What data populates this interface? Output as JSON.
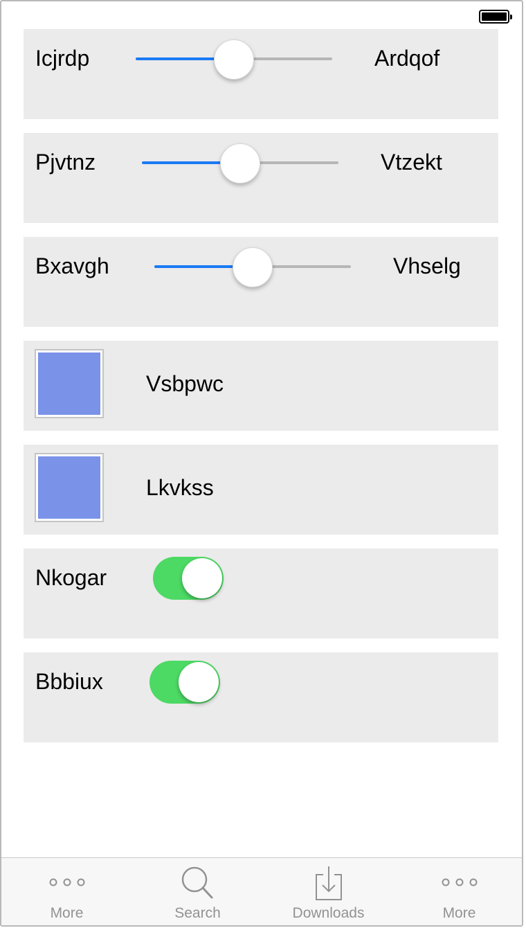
{
  "rows": {
    "slider1": {
      "label": "Icjrdp",
      "end_label": "Ardqof",
      "value": 0.5
    },
    "slider2": {
      "label": "Pjvtnz",
      "end_label": "Vtzekt",
      "value": 0.5
    },
    "slider3": {
      "label": "Bxavgh",
      "end_label": "Vhselg",
      "value": 0.5
    },
    "color1": {
      "label": "Vsbpwc",
      "color": "#7a92e8"
    },
    "color2": {
      "label": "Lkvkss",
      "color": "#7a92e8"
    },
    "switch1": {
      "label": "Nkogar",
      "on": true
    },
    "switch2": {
      "label": "Bbbiux",
      "on": true
    }
  },
  "tabbar": {
    "tabs": [
      {
        "label": "More",
        "icon": "more-icon"
      },
      {
        "label": "Search",
        "icon": "search-icon"
      },
      {
        "label": "Downloads",
        "icon": "downloads-icon"
      },
      {
        "label": "More",
        "icon": "more-icon"
      }
    ]
  },
  "colors": {
    "accent": "#1a7af5",
    "switch_on": "#4cd964",
    "row_bg": "#ebebeb"
  }
}
